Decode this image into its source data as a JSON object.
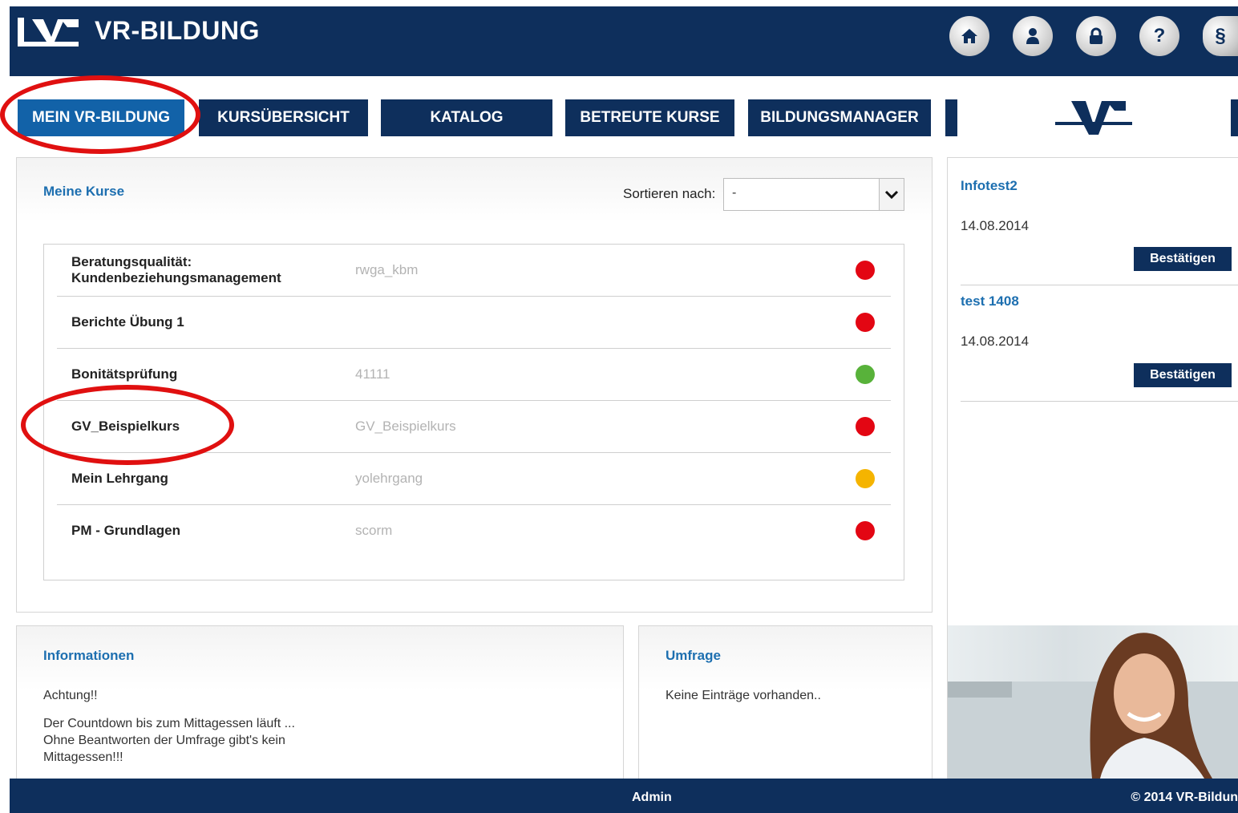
{
  "header": {
    "brand": "VR-BILDUNG",
    "icons": [
      "home-icon",
      "user-icon",
      "lock-icon",
      "help-icon",
      "paragraph-icon"
    ],
    "paragraph_symbol": "§",
    "help_symbol": "?"
  },
  "nav": {
    "items": [
      {
        "label": "MEIN VR-BILDUNG",
        "active": true
      },
      {
        "label": "KURSÜBERSICHT",
        "active": false
      },
      {
        "label": "KATALOG",
        "active": false
      },
      {
        "label": "BETREUTE KURSE",
        "active": false
      },
      {
        "label": "BILDUNGSMANAGER",
        "active": false
      }
    ]
  },
  "courses": {
    "title": "Meine Kurse",
    "sort_label": "Sortieren nach:",
    "sort_value": "-",
    "rows": [
      {
        "name": "Beratungsqualität: Kundenbeziehungsmanagement",
        "code": "rwga_kbm",
        "status": "#e30613"
      },
      {
        "name": "Berichte Übung 1",
        "code": "",
        "status": "#e30613"
      },
      {
        "name": "Bonitätsprüfung",
        "code": "41111",
        "status": "#58b23a"
      },
      {
        "name": "GV_Beispielkurs",
        "code": "GV_Beispielkurs",
        "status": "#e30613"
      },
      {
        "name": "Mein Lehrgang",
        "code": "yolehrgang",
        "status": "#f5b400"
      },
      {
        "name": "PM - Grundlagen",
        "code": "scorm",
        "status": "#e30613"
      }
    ]
  },
  "sidebar": {
    "items": [
      {
        "title": "Infotest2",
        "date": "14.08.2014",
        "button": "Bestätigen"
      },
      {
        "title": "test 1408",
        "date": "14.08.2014",
        "button": "Bestätigen"
      }
    ]
  },
  "info": {
    "title": "Informationen",
    "line1": "Achtung!!",
    "line2": "Der Countdown bis zum Mittagessen läuft ...",
    "line3": "Ohne Beantworten der Umfrage gibt's kein",
    "line4": "Mittagessen!!!"
  },
  "survey": {
    "title": "Umfrage",
    "text": "Keine Einträge vorhanden.."
  },
  "footer": {
    "user": "Admin",
    "copyright": "© 2014 VR-Bildun"
  }
}
